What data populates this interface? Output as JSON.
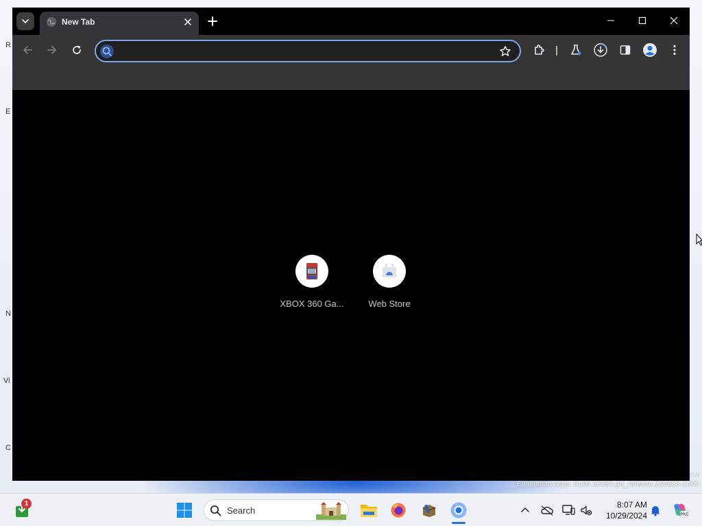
{
  "browser": {
    "tab": {
      "title": "New Tab"
    },
    "omnibox": {
      "value": "",
      "placeholder": ""
    },
    "shortcuts": [
      {
        "label": "XBOX 360 Ga..."
      },
      {
        "label": "Web Store"
      }
    ]
  },
  "desktop": {
    "edge_letters": [
      "R",
      "E",
      "N",
      "Vi",
      "C"
    ],
    "watermark_top": "ew",
    "watermark": "Evaluation copy. Build 26080.ge_release.240308-1400"
  },
  "taskbar": {
    "search_label": "Search",
    "notification_count": "1",
    "time": "8:07 AM",
    "date": "10/29/2024"
  },
  "colors": {
    "accent": "#7ea6e8",
    "tab_bg": "#35363a",
    "toolbar_bg": "#353535",
    "taskbar_active": "#2b6fd6"
  }
}
